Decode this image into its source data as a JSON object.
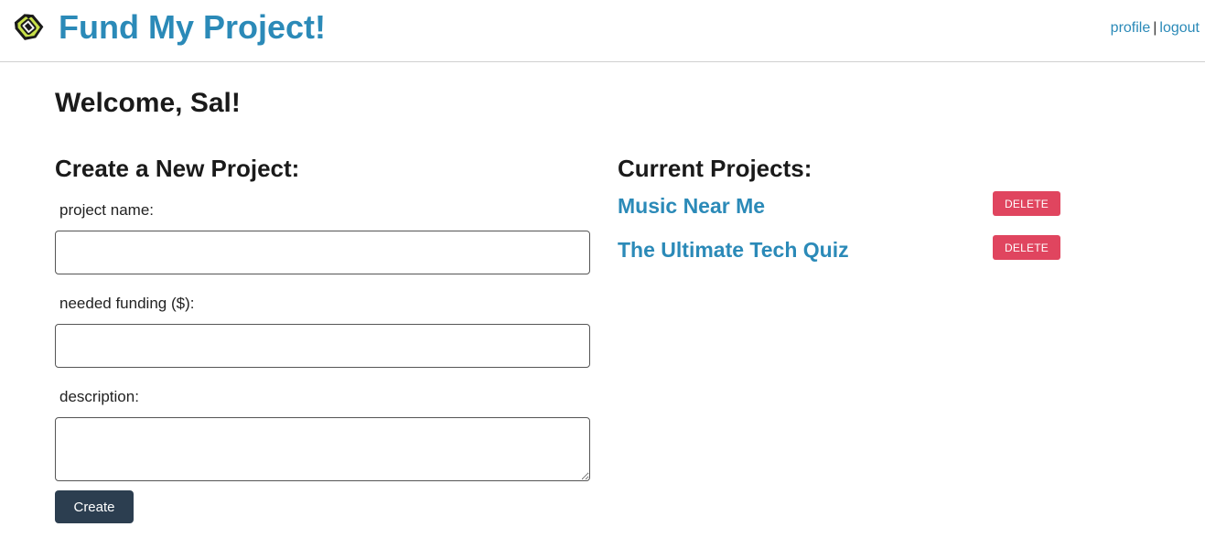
{
  "header": {
    "title": "Fund My Project!",
    "nav": {
      "profile": "profile",
      "separator": "|",
      "logout": "logout"
    }
  },
  "welcome": "Welcome, Sal!",
  "create_form": {
    "heading": "Create a New Project:",
    "fields": [
      {
        "label": "project name:",
        "value": "",
        "placeholder": ""
      },
      {
        "label": "needed funding ($):",
        "value": "",
        "placeholder": ""
      },
      {
        "label": "description:",
        "value": "",
        "placeholder": ""
      }
    ],
    "submit_label": "Create"
  },
  "current_projects": {
    "heading": "Current Projects:",
    "items": [
      {
        "name": "Music Near Me",
        "delete_label": "DELETE"
      },
      {
        "name": "The Ultimate Tech Quiz",
        "delete_label": "DELETE"
      }
    ]
  },
  "colors": {
    "brand": "#2b8ab8",
    "create_button": "#2c3e50",
    "delete_button": "#e0455f"
  },
  "icons": {
    "logo": "fund-logo-icon"
  }
}
